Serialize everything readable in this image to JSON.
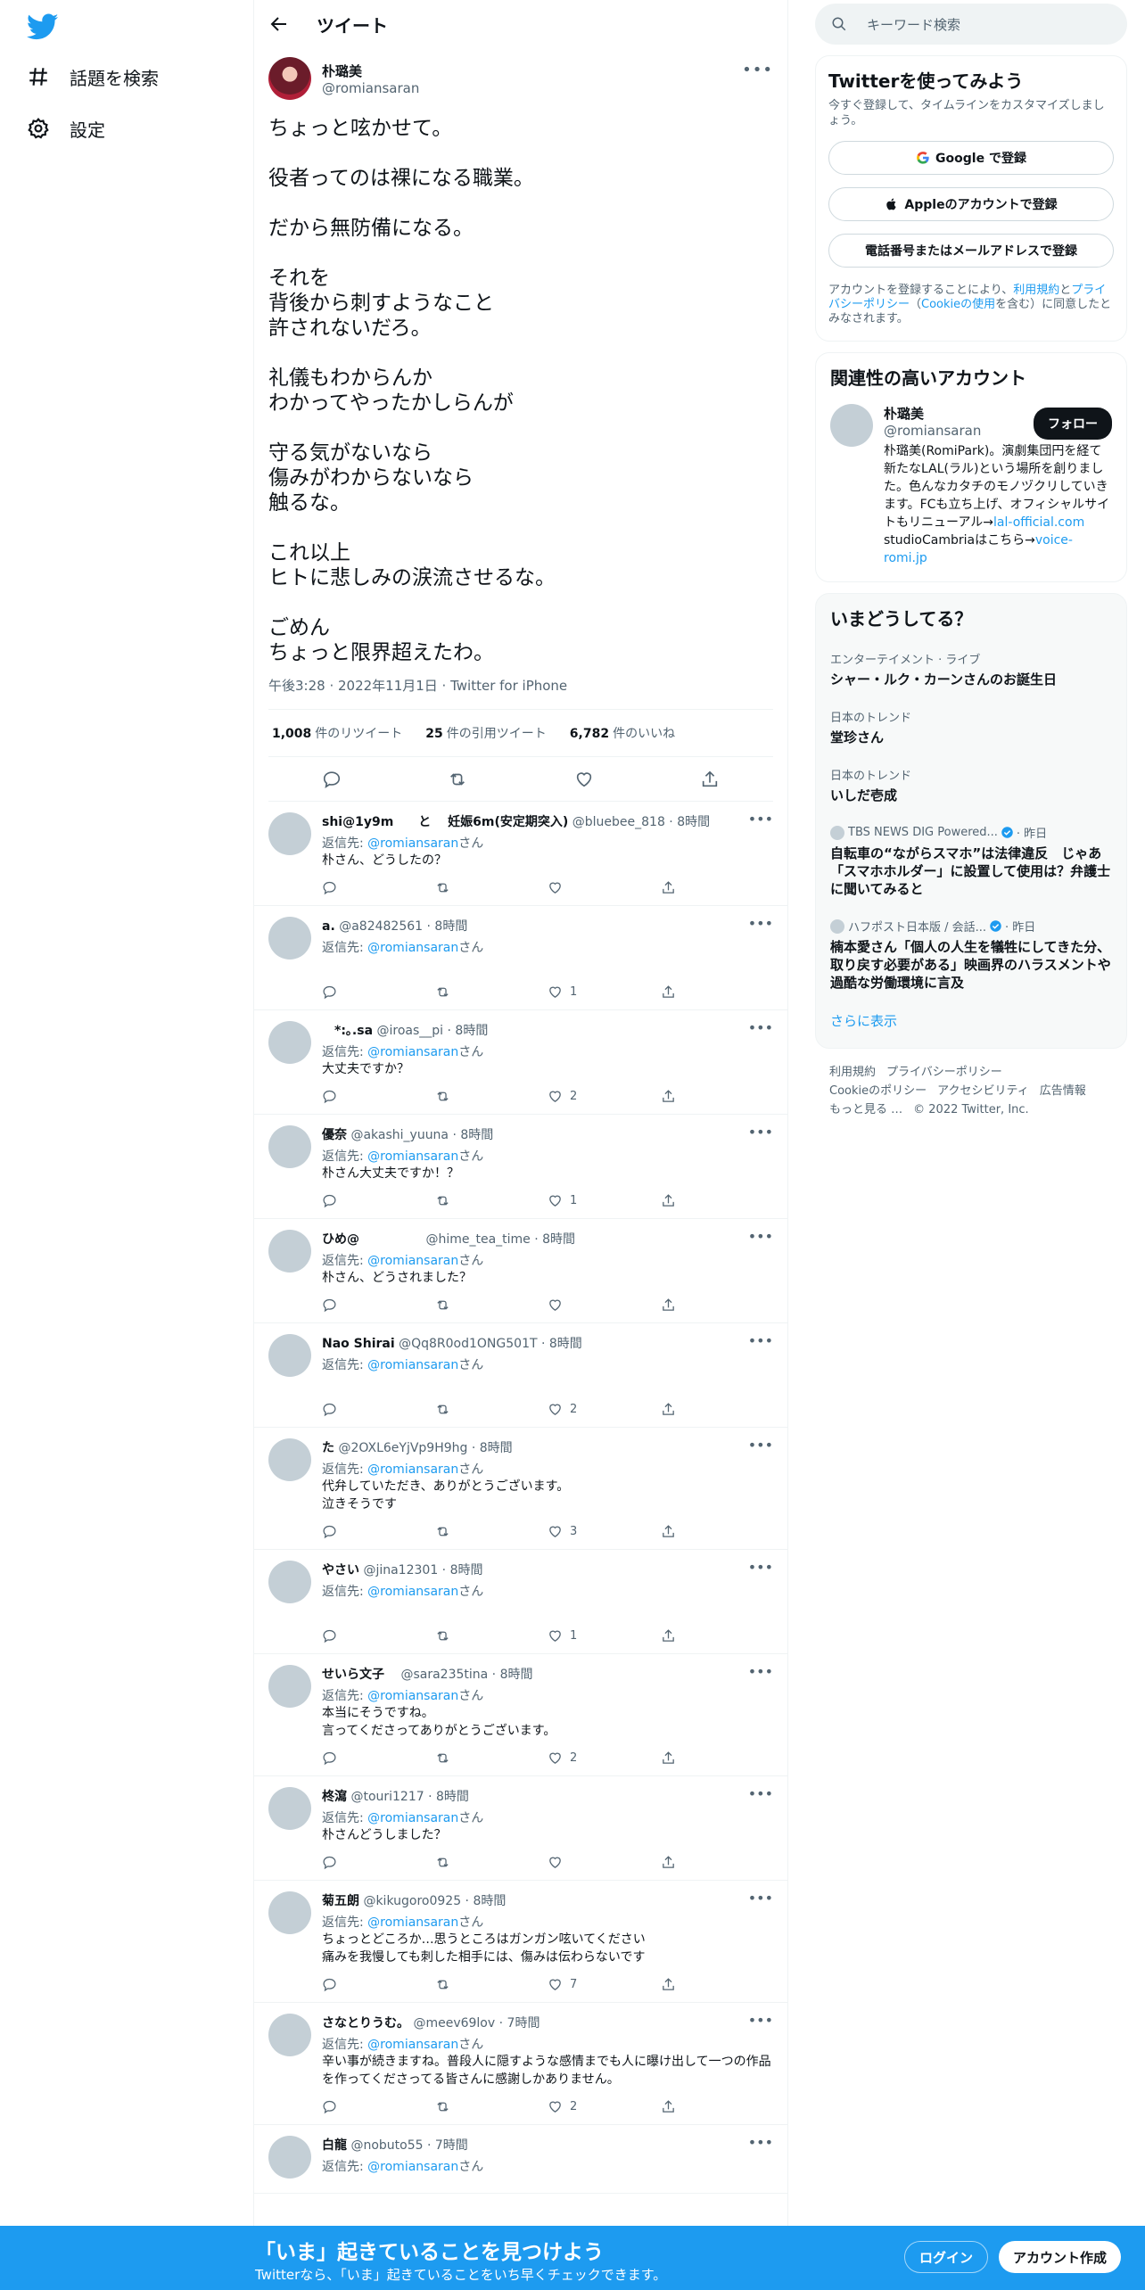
{
  "nav": {
    "explore_label": "話題を検索",
    "settings_label": "設定"
  },
  "header": {
    "title": "ツイート"
  },
  "main_tweet": {
    "name": "朴璐美",
    "handle": "@romiansaran",
    "text": "ちょっと呟かせて。\n\n役者ってのは裸になる職業。\n\nだから無防備になる。\n\nそれを\n背後から刺すようなこと\n許されないだろ。\n\n礼儀もわからんか\nわかってやったかしらんが\n\n守る気がないなら\n傷みがわからないなら\n触るな。\n\nこれ以上\nヒトに悲しみの涙流させるな。\n\nごめん\nちょっと限界超えたわ。",
    "meta": "午後3:28 · 2022年11月1日 · Twitter for iPhone",
    "retweets_count": "1,008",
    "retweets_label": "件のリツイート",
    "quotes_count": "25",
    "quotes_label": "件の引用ツイート",
    "likes_count": "6,782",
    "likes_label": "件のいいね"
  },
  "replies": [
    {
      "name": "shi@1y9m　　と　 妊娠6m(安定期突入)",
      "handle": "@bluebee_818",
      "time": "8時間",
      "to": "@romiansaran",
      "text": "朴さん、どうしたの？",
      "likes": ""
    },
    {
      "name": "a.",
      "handle": "@a82482561",
      "time": "8時間",
      "to": "@romiansaran",
      "text": "",
      "likes": "1"
    },
    {
      "name": "　*:｡.sa",
      "handle": "@iroas__pi",
      "time": "8時間",
      "to": "@romiansaran",
      "text": "大丈夫ですか？",
      "likes": "2"
    },
    {
      "name": "優奈",
      "handle": "@akashi_yuuna",
      "time": "8時間",
      "to": "@romiansaran",
      "text": "朴さん大丈夫ですか！？",
      "likes": "1"
    },
    {
      "name": "ひめ@　　　　　",
      "handle": "@hime_tea_time",
      "time": "8時間",
      "to": "@romiansaran",
      "text": "朴さん、どうされました？",
      "likes": ""
    },
    {
      "name": "Nao Shirai",
      "handle": "@Qq8R0od1ONG501T",
      "time": "8時間",
      "to": "@romiansaran",
      "text": "",
      "likes": "2"
    },
    {
      "name": "た",
      "handle": "@2OXL6eYjVp9H9hg",
      "time": "8時間",
      "to": "@romiansaran",
      "text": "代弁していただき、ありがとうございます。\n泣きそうです",
      "likes": "3"
    },
    {
      "name": "やさい",
      "handle": "@jina12301",
      "time": "8時間",
      "to": "@romiansaran",
      "text": "",
      "likes": "1"
    },
    {
      "name": "せいら文子　",
      "handle": "@sara235tina",
      "time": "8時間",
      "to": "@romiansaran",
      "text": "本当にそうですね。\n言ってくださってありがとうございます。",
      "likes": "2"
    },
    {
      "name": "柊瀉",
      "handle": "@touri1217",
      "time": "8時間",
      "to": "@romiansaran",
      "text": "朴さんどうしました？",
      "likes": ""
    },
    {
      "name": "菊五朗",
      "handle": "@kikugoro0925",
      "time": "8時間",
      "to": "@romiansaran",
      "text": "ちょっとどころか…思うところはガンガン呟いてください\n痛みを我慢しても刺した相手には、傷みは伝わらないです",
      "likes": "7"
    },
    {
      "name": "さなとりうむ。",
      "handle": "@meev69lov",
      "time": "7時間",
      "to": "@romiansaran",
      "text": "辛い事が続きますね。普段人に隠すような感情までも人に曝け出して一つの作品を作ってくださってる皆さんに感謝しかありません。",
      "likes": "2"
    },
    {
      "name": "白龍",
      "handle": "@nobuto55",
      "time": "7時間",
      "to": "@romiansaran",
      "text": "",
      "likes": ""
    }
  ],
  "reply_strings": {
    "replying_prefix": "返信先: ",
    "replying_suffix": "さん"
  },
  "search": {
    "placeholder": "キーワード検索"
  },
  "signup": {
    "title": "Twitterを使ってみよう",
    "subtitle": "今すぐ登録して、タイムラインをカスタマイズしましょう。",
    "google": "Google で登録",
    "apple": "Appleのアカウントで登録",
    "phone": "電話番号またはメールアドレスで登録",
    "terms_pre": "アカウントを登録することにより、",
    "terms_link1": "利用規約",
    "terms_and": "と",
    "terms_link2": "プライバシーポリシー",
    "terms_paren_open": "（",
    "terms_link3": "Cookieの使用",
    "terms_post": "を含む）に同意したとみなされます。"
  },
  "related": {
    "title": "関連性の高いアカウント",
    "name": "朴璐美",
    "handle": "@romiansaran",
    "follow": "フォロー",
    "bio": "朴璐美(RomiPark)。演劇集団円を経て新たなLAL(ラル)という場所を創りました。色んなカタチのモノヅクリしていきます。FCも立ち上げ、オフィシャルサイトもリニューアル→",
    "bio_link1": "lal-official.com",
    "bio_mid": " studioCambriaはこちら→",
    "bio_link2": "voice-romi.jp"
  },
  "trends": {
    "title": "いまどうしてる？",
    "items": [
      {
        "category": "エンターテイメント · ライブ",
        "name": "シャー・ルク・カーンさんのお誕生日"
      },
      {
        "category": "日本のトレンド",
        "name": "堂珍さん"
      },
      {
        "category": "日本のトレンド",
        "name": "いしだ壱成"
      }
    ],
    "news": [
      {
        "source": "TBS NEWS DIG Powered...",
        "time": "· 昨日",
        "title": "自転車の“ながらスマホ”は法律違反　じゃあ「スマホホルダー」に設置して使用は？弁護士に聞いてみると"
      },
      {
        "source": "ハフポスト日本版 / 会話...",
        "time": "· 昨日",
        "title": "楠本愛さん「個人の人生を犠牲にしてきた分、取り戻す必要がある」映画界のハラスメントや過酷な労働環境に言及"
      }
    ],
    "show_more": "さらに表示"
  },
  "footer": {
    "links": [
      "利用規約",
      "プライバシーポリシー",
      "Cookieのポリシー",
      "アクセシビリティ",
      "広告情報",
      "もっと見る …"
    ],
    "copyright": "© 2022 Twitter, Inc."
  },
  "bottom_bar": {
    "title": "「いま」起きていることを見つけよう",
    "subtitle": "Twitterなら、「いま」起きていることをいち早くチェックできます。",
    "login": "ログイン",
    "signup": "アカウント作成"
  },
  "colors": {
    "accent": "#1d9bf0",
    "text": "#0f1419",
    "muted": "#536471"
  }
}
